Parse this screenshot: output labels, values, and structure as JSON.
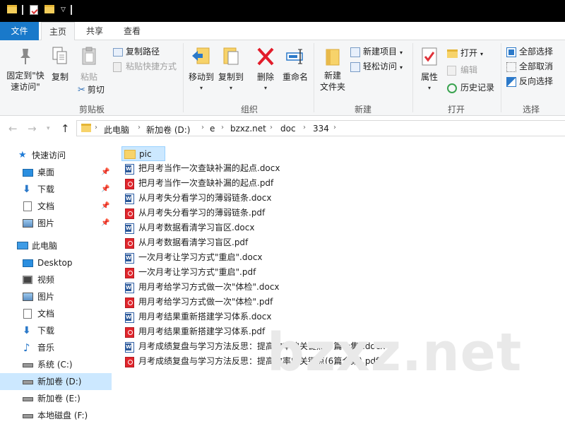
{
  "quick_access_toolbar": {
    "icons": [
      "folder-icon",
      "properties-icon",
      "new-folder-icon",
      "customize-dropdown-icon"
    ]
  },
  "tabs": [
    {
      "label": "文件"
    },
    {
      "label": "主页"
    },
    {
      "label": "共享"
    },
    {
      "label": "查看"
    }
  ],
  "ribbon": {
    "clipboard": {
      "pin_label": "固定到\"快速访问\"",
      "copy_label": "复制",
      "paste_label": "粘贴",
      "cut_label": "剪切",
      "copy_path_label": "复制路径",
      "paste_shortcut_label": "粘贴快捷方式",
      "group_label": "剪贴板"
    },
    "organize": {
      "move_to_label": "移动到",
      "copy_to_label": "复制到",
      "delete_label": "删除",
      "rename_label": "重命名",
      "group_label": "组织"
    },
    "new": {
      "new_folder_label": "新建\n文件夹",
      "new_item_label": "新建项目",
      "easy_access_label": "轻松访问",
      "group_label": "新建"
    },
    "open": {
      "properties_label": "属性",
      "open_label": "打开",
      "edit_label": "编辑",
      "history_label": "历史记录",
      "group_label": "打开"
    },
    "select": {
      "select_all_label": "全部选择",
      "select_none_label": "全部取消",
      "invert_label": "反向选择",
      "group_label": "选择"
    }
  },
  "address": {
    "crumbs": [
      "此电脑",
      "新加卷 (D:)",
      "e",
      "bzxz.net",
      "doc",
      "334"
    ]
  },
  "sidebar": {
    "quick_access_label": "快速访问",
    "quick_items": [
      {
        "label": "桌面",
        "icon": "desktop-icon"
      },
      {
        "label": "下载",
        "icon": "download-icon"
      },
      {
        "label": "文档",
        "icon": "documents-icon"
      },
      {
        "label": "图片",
        "icon": "pictures-icon"
      }
    ],
    "this_pc_label": "此电脑",
    "pc_items": [
      {
        "label": "Desktop",
        "icon": "desktop-icon"
      },
      {
        "label": "视频",
        "icon": "videos-icon"
      },
      {
        "label": "图片",
        "icon": "pictures-icon"
      },
      {
        "label": "文档",
        "icon": "documents-icon"
      },
      {
        "label": "下载",
        "icon": "download-icon"
      },
      {
        "label": "音乐",
        "icon": "music-icon"
      },
      {
        "label": "系统 (C:)",
        "icon": "system-drive-icon"
      },
      {
        "label": "新加卷 (D:)",
        "icon": "drive-icon"
      },
      {
        "label": "新加卷 (E:)",
        "icon": "drive-icon"
      },
      {
        "label": "本地磁盘 (F:)",
        "icon": "drive-icon"
      }
    ]
  },
  "files": [
    {
      "name": "pic",
      "type": "folder"
    },
    {
      "name": "把月考当作一次查缺补漏的起点.docx",
      "type": "docx"
    },
    {
      "name": "把月考当作一次查缺补漏的起点.pdf",
      "type": "pdf"
    },
    {
      "name": "从月考失分看学习的薄弱链条.docx",
      "type": "docx"
    },
    {
      "name": "从月考失分看学习的薄弱链条.pdf",
      "type": "pdf"
    },
    {
      "name": "从月考数据看清学习盲区.docx",
      "type": "docx"
    },
    {
      "name": "从月考数据看清学习盲区.pdf",
      "type": "pdf"
    },
    {
      "name": "一次月考让学习方式\"重启\".docx",
      "type": "docx"
    },
    {
      "name": "一次月考让学习方式\"重启\".pdf",
      "type": "pdf"
    },
    {
      "name": "用月考给学习方式做一次\"体检\".docx",
      "type": "docx"
    },
    {
      "name": "用月考给学习方式做一次\"体检\".pdf",
      "type": "pdf"
    },
    {
      "name": "用月考结果重新搭建学习体系.docx",
      "type": "docx"
    },
    {
      "name": "用月考结果重新搭建学习体系.pdf",
      "type": "pdf"
    },
    {
      "name": "月考成绩复盘与学习方法反思：提高效率的关键点(6篇合集).docx",
      "type": "docx"
    },
    {
      "name": "月考成绩复盘与学习方法反思：提高效率的关键点(6篇合集).pdf",
      "type": "pdf"
    }
  ],
  "watermark": "bzxz.net",
  "colors": {
    "file_tab": "#1979ca",
    "selection": "#cce8ff",
    "folder": "#f7d36a",
    "pdf": "#e1252c",
    "docx": "#2b5797"
  }
}
